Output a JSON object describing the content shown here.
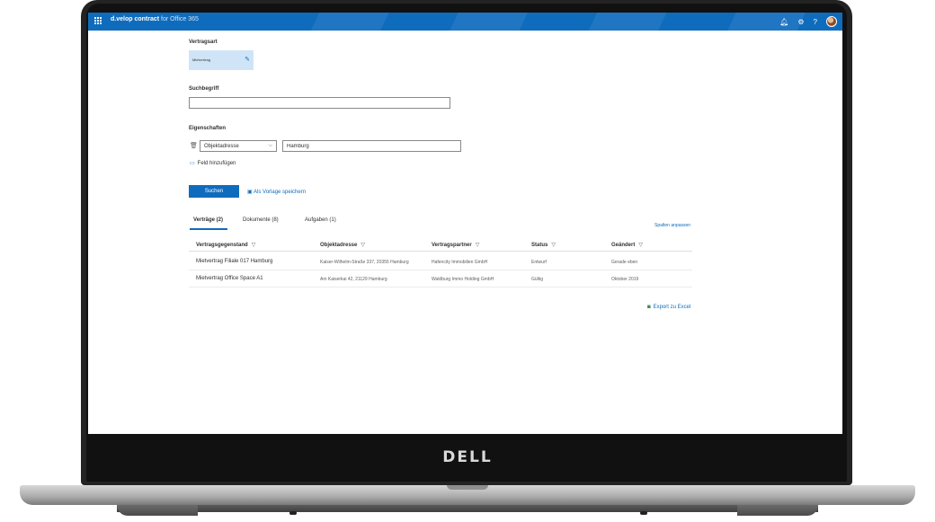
{
  "laptop": {
    "brand": "DELL"
  },
  "appbar": {
    "brand_bold": "d.velop contract",
    "brand_light": " for Office 365"
  },
  "form": {
    "contract_type_label": "Vertragsart",
    "contract_type_value": "Mietvertrag",
    "search_label": "Suchbegriff",
    "search_value": "",
    "properties_label": "Eigenschaften",
    "property_select": "Objektadresse",
    "property_value": "Hamburg",
    "add_field": "Feld hinzufügen",
    "search_button": "Suchen",
    "save_template": "Als Vorlage speichern"
  },
  "tabs": [
    {
      "label": "Verträge (2)",
      "active": true
    },
    {
      "label": "Dokumente (8)",
      "active": false
    },
    {
      "label": "Aufgaben (1)",
      "active": false
    }
  ],
  "columns_link": "Spalten anpassen",
  "table": {
    "headers": [
      "Vertragsgegenstand",
      "Objektadresse",
      "Vertragspartner",
      "Status",
      "Geändert"
    ],
    "rows": [
      [
        "Mietvertrag Filiale 017 Hamburg",
        "Kaiser-Wilhelm-Straße 337, 20355 Hamburg",
        "Hafencity Immobilien GmbH",
        "Entwurf",
        "Gerade eben"
      ],
      [
        "Mietvertrag Office Space A1",
        "Am Kaiserkai 42, 21129 Hamburg",
        "Waldburg Immo Holding GmbH",
        "Gültig",
        "Oktober 2019"
      ]
    ]
  },
  "export": "Export zu Excel",
  "colors": {
    "accent": "#0f6cbd",
    "tile": "#cfe4f7"
  }
}
